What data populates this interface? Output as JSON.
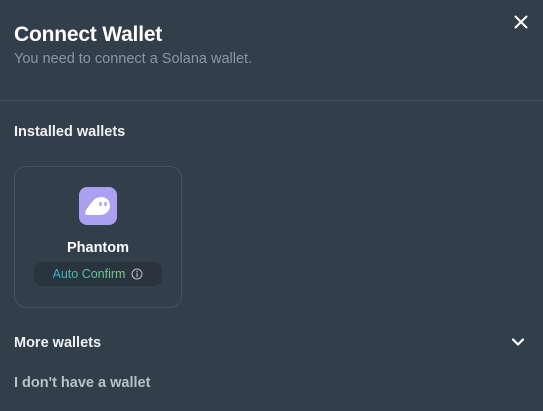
{
  "header": {
    "title": "Connect Wallet",
    "subtitle": "You need to connect a Solana wallet.",
    "close_icon": "close-icon"
  },
  "installed": {
    "section_title": "Installed wallets",
    "wallets": [
      {
        "name": "Phantom",
        "badge": "Auto Confirm",
        "logo_icon": "phantom-ghost-icon",
        "logo_color": "#ab9ff2",
        "badge_icon": "info-icon"
      }
    ]
  },
  "more_wallets": {
    "label": "More wallets",
    "icon": "chevron-down-icon"
  },
  "no_wallet": {
    "label": "I don't have a wallet"
  },
  "colors": {
    "background": "#323e4a",
    "divider": "#46525e",
    "subtitle": "#8b96a2",
    "badge_gradient_start": "#34b3c8",
    "badge_gradient_end": "#86d07f"
  }
}
